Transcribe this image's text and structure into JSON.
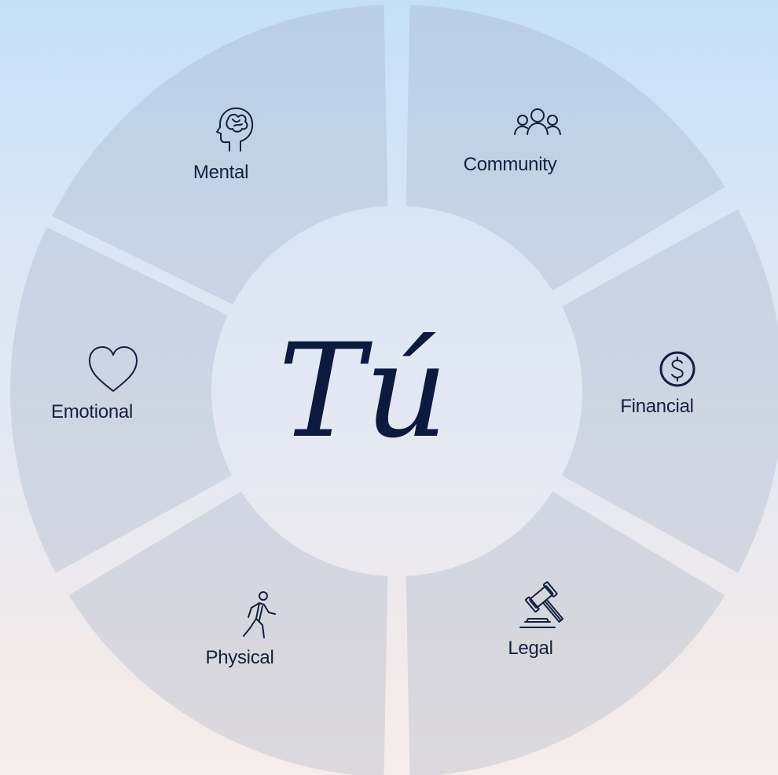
{
  "center": {
    "label": "Tú"
  },
  "segments": [
    {
      "id": "mental",
      "label": "Mental",
      "icon": "brain-head-icon"
    },
    {
      "id": "community",
      "label": "Community",
      "icon": "people-group-icon"
    },
    {
      "id": "financial",
      "label": "Financial",
      "icon": "dollar-coin-icon"
    },
    {
      "id": "legal",
      "label": "Legal",
      "icon": "gavel-icon"
    },
    {
      "id": "physical",
      "label": "Physical",
      "icon": "walking-person-icon"
    },
    {
      "id": "emotional",
      "label": "Emotional",
      "icon": "heart-icon"
    }
  ],
  "colors": {
    "segment_fill": "rgba(150,165,185,0.28)",
    "text": "#14203f",
    "center_text": "#0d1a3f"
  }
}
